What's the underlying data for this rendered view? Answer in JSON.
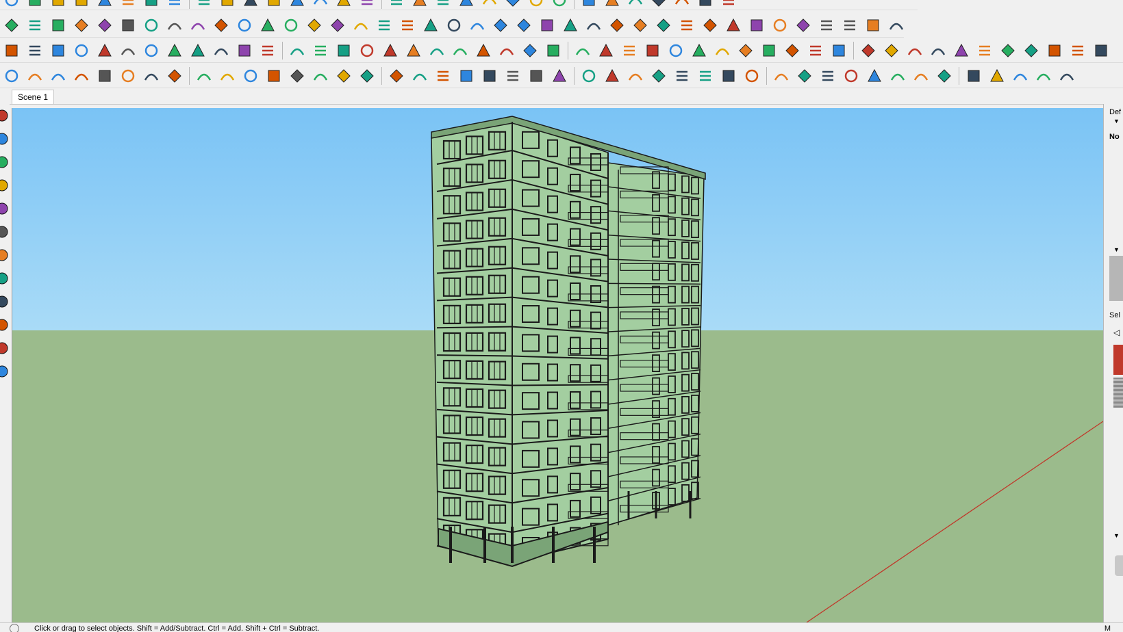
{
  "scene_tabs": [
    {
      "label": "Scene 1"
    }
  ],
  "status": {
    "hint": "Click or drag to select objects. Shift = Add/Subtract. Ctrl = Add. Shift + Ctrl = Subtract.",
    "measurements_label": "M"
  },
  "tray": {
    "default_label": "Def",
    "none_label": "No",
    "select_label": "Sel"
  },
  "colors": {
    "sky_top": "#7ac3f5",
    "sky_bottom": "#a9dbf7",
    "ground": "#9bbb8c",
    "building_face": "#a3cea0",
    "building_dark": "#7aa477",
    "red_axis": "#c0392b"
  },
  "toolbar_icons": {
    "row0": [
      "select-icon",
      "eraser-icon",
      "pencil-icon",
      "check-icon",
      "paint-bucket-icon",
      "layers-icon",
      "rotate-icon",
      "push-pull-icon",
      "undo-icon",
      "component-icon",
      "pin-icon",
      "measure-icon",
      "hand-icon",
      "tag-icon",
      "lamp-icon",
      "zoom-icon",
      "search-icon",
      "cube-icon",
      "wave-icon",
      "sandbox-icon",
      "settings-icon",
      "globe-icon",
      "camera-icon",
      "book-icon",
      "layers-stack-icon",
      "sphere-icon",
      "sphere-icon",
      "sphere-icon",
      "export-icon",
      "stop-icon",
      "earth-icon"
    ],
    "row1": [
      "polygon-icon",
      "dotted-line-icon",
      "paint-icon",
      "scissors-icon",
      "lasso-icon",
      "shape-icon",
      "spiral-icon",
      "box-icon",
      "sphere-wire-icon",
      "sweep-icon",
      "corner-icon",
      "corner-icon",
      "slope-icon",
      "curve-icon",
      "table-icon",
      "fan-icon",
      "stairs-icon",
      "railing-icon",
      "hand-icon",
      "roof-icon",
      "mirror-icon",
      "stack-icon",
      "ramp-icon",
      "spring-icon",
      "branches-icon",
      "branches-icon",
      "branches-icon",
      "sofa-icon",
      "roof-icon",
      "frame-icon",
      "door-icon",
      "grid-icon",
      "pattern-icon",
      "diagonal-icon",
      "fence-icon",
      "fence-icon",
      "knot-icon",
      "knot-icon",
      "grass-icon",
      "hatch-icon",
      "house-icon"
    ],
    "row2": [
      "face-icon",
      "diamond-blue-icon",
      "diamond-yellow-icon",
      "diamond-green-icon",
      "diamond-red-icon",
      "diamond-outline-icon",
      "arc-orange-icon",
      "square-red-icon",
      "list-icon",
      "flag-icon",
      "box-brown-icon",
      "link-icon",
      "curve-tool-icon",
      "dots-icon",
      "plus-red-icon",
      "plus-green-icon",
      "plus-blue-icon",
      "cone-icon",
      "cone-icon",
      "triangle-icon",
      "loop-icon",
      "loop-icon",
      "loop-icon",
      "move-icon",
      "cup-icon",
      "arrow-back-icon",
      "cross-icon",
      "cube-add-icon",
      "cube-sub-icon",
      "cube-int-icon",
      "cube-red-icon",
      "cube-multi-icon",
      "panel-icon",
      "grid-yellow-icon",
      "grid-yellow-icon",
      "grid-yellow-icon",
      "dot-cross-icon",
      "circle-dash-icon",
      "scatter-icon",
      "line-icon",
      "dimension-icon",
      "rotate-obj-icon",
      "prism-icon",
      "cube-blue-icon",
      "prism-blue-icon",
      "hand-stop-icon",
      "balance-icon"
    ],
    "row3": [
      "shield-icon",
      "house-tool-icon",
      "mesh-icon",
      "line-bridge-icon",
      "zigzag-icon",
      "zigzag-icon",
      "curve-n-icon",
      "curve-t-icon",
      "arc-green-icon",
      "rectangle-icon",
      "circle-icon",
      "arc-icon",
      "polyline-icon",
      "bend-icon",
      "bend-icon",
      "arc-red-icon",
      "freehand-icon",
      "polygon-outline-icon",
      "wrench-icon",
      "ellipse-icon",
      "pie-icon",
      "box-green-icon",
      "box-tool-icon",
      "cursor-icon",
      "scale-up-icon",
      "scale-down-icon",
      "align-icon",
      "align-icon",
      "align-icon",
      "row-icon",
      "row-icon",
      "row-icon",
      "grid-line-icon",
      "grid-line-icon",
      "grid-line-icon",
      "table-blue-icon",
      "table-blue-icon",
      "table-blue-icon",
      "map-icon",
      "map-icon",
      "hat-icon",
      "checker-icon",
      "copy-icon",
      "tree-icon",
      "grid-tree-icon"
    ]
  }
}
